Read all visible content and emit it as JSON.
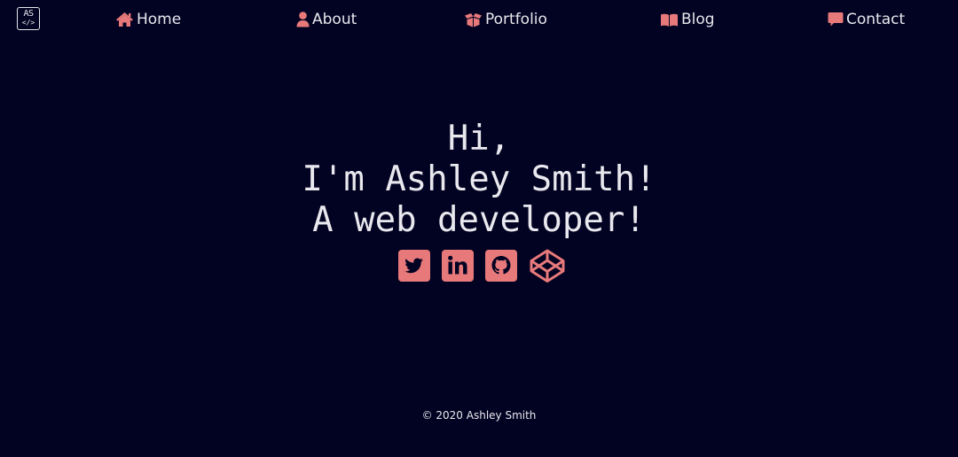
{
  "logo": {
    "line1": "AS",
    "line2": "</>"
  },
  "nav": {
    "home": "Home",
    "about": "About",
    "portfolio": "Portfolio",
    "blog": "Blog",
    "contact": "Contact"
  },
  "hero": {
    "line1": "Hi,",
    "line2": "I'm Ashley Smith!",
    "line3": "A web developer!"
  },
  "social": [
    "twitter-icon",
    "linkedin-icon",
    "github-icon",
    "codepen-icon"
  ],
  "footer": {
    "copyright": "© 2020 Ashley Smith"
  },
  "colors": {
    "background": "#020222",
    "text": "#e8e8ee",
    "accent": "#e7797a"
  }
}
